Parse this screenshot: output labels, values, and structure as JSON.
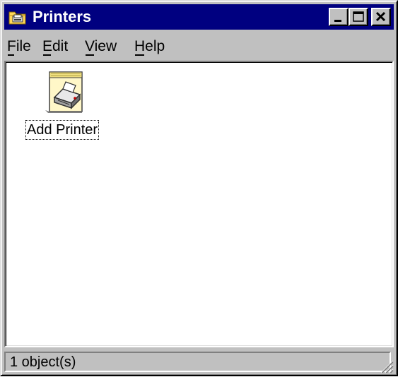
{
  "window": {
    "title": "Printers",
    "title_icon": "printers-folder-icon",
    "controls": [
      "minimize-icon",
      "maximize-icon",
      "close-icon"
    ]
  },
  "menu": {
    "items": [
      {
        "label": "File"
      },
      {
        "label": "Edit"
      },
      {
        "label": "View"
      },
      {
        "label": "Help"
      }
    ]
  },
  "content": {
    "items": [
      {
        "label": "Add Printer",
        "icon": "add-printer-icon"
      }
    ]
  },
  "status": {
    "text": "1 object(s)"
  },
  "colors": {
    "title_bar": "#000080",
    "face": "#c0c0c0",
    "window_bg": "#ffffff"
  }
}
